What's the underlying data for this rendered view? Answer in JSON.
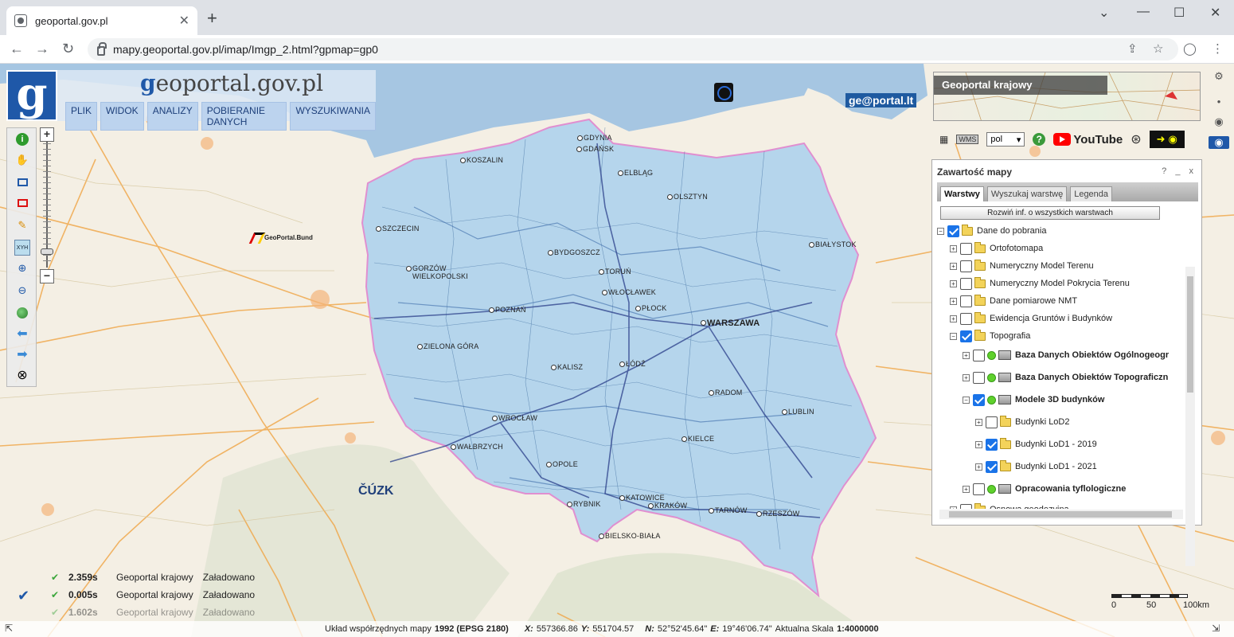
{
  "browser": {
    "tab_title": "geoportal.gov.pl",
    "url": "mapy.geoportal.gov.pl/imap/Imgp_2.html?gpmap=gp0"
  },
  "header": {
    "site_prefix": "g",
    "site_rest": "eoportal.gov.pl",
    "menu": [
      "PLIK",
      "WIDOK",
      "ANALIZY",
      "POBIERANIE DANYCH",
      "WYSZUKIWANIA"
    ]
  },
  "map": {
    "cities": [
      {
        "name": "GDYNIA",
        "big": false
      },
      {
        "name": "GDAŃSK",
        "big": false
      },
      {
        "name": "KOSZALIN",
        "big": false
      },
      {
        "name": "ELBLĄG",
        "big": false
      },
      {
        "name": "OLSZTYN",
        "big": false
      },
      {
        "name": "SZCZECIN",
        "big": false
      },
      {
        "name": "BYDGOSZCZ",
        "big": false
      },
      {
        "name": "TORUŃ",
        "big": false
      },
      {
        "name": "BIAŁYSTOK",
        "big": false
      },
      {
        "name": "GORZÓW WIELKOPOLSKI",
        "big": false
      },
      {
        "name": "WŁOCŁAWEK",
        "big": false
      },
      {
        "name": "PŁOCK",
        "big": false
      },
      {
        "name": "POZNAŃ",
        "big": false
      },
      {
        "name": "WARSZAWA",
        "big": true
      },
      {
        "name": "ZIELONA GÓRA",
        "big": false
      },
      {
        "name": "KALISZ",
        "big": false
      },
      {
        "name": "ŁÓDŹ",
        "big": false
      },
      {
        "name": "RADOM",
        "big": false
      },
      {
        "name": "LUBLIN",
        "big": false
      },
      {
        "name": "WROCŁAW",
        "big": false
      },
      {
        "name": "WAŁBRZYCH",
        "big": false
      },
      {
        "name": "KIELCE",
        "big": false
      },
      {
        "name": "OPOLE",
        "big": false
      },
      {
        "name": "KATOWICE",
        "big": false
      },
      {
        "name": "RYBNIK",
        "big": false
      },
      {
        "name": "KRAKÓW",
        "big": false
      },
      {
        "name": "TARNÓW",
        "big": false
      },
      {
        "name": "RZESZÓW",
        "big": false
      },
      {
        "name": "BIELSKO-BIAŁA",
        "big": false
      }
    ],
    "logos": {
      "lt": "ge@portal.lt",
      "bund": "GeoPortal.Bund",
      "cuzk": "ČÚZK"
    }
  },
  "right_panel": {
    "preview_title": "Geoportal krajowy",
    "language": "pol",
    "youtube": "YouTube"
  },
  "layers_panel": {
    "title": "Zawartość mapy",
    "controls": "? _ x",
    "tabs": [
      "Warstwy",
      "Wyszukaj warstwę",
      "Legenda"
    ],
    "expand_all": "Rozwiń inf. o wszystkich warstwach",
    "tree": [
      {
        "label": "Dane do pobrania",
        "level": 0,
        "expander": "−",
        "checked": true,
        "icon": "folder",
        "bold": false
      },
      {
        "label": "Ortofotomapa",
        "level": 1,
        "expander": "+",
        "checked": false,
        "icon": "folder",
        "bold": false
      },
      {
        "label": "Numeryczny Model Terenu",
        "level": 1,
        "expander": "+",
        "checked": false,
        "icon": "folder",
        "bold": false
      },
      {
        "label": "Numeryczny Model Pokrycia Terenu",
        "level": 1,
        "expander": "+",
        "checked": false,
        "icon": "folder",
        "bold": false
      },
      {
        "label": "Dane pomiarowe NMT",
        "level": 1,
        "expander": "+",
        "checked": false,
        "icon": "folder",
        "bold": false
      },
      {
        "label": "Ewidencja Gruntów i Budynków",
        "level": 1,
        "expander": "+",
        "checked": false,
        "icon": "folder",
        "bold": false
      },
      {
        "label": "Topografia",
        "level": 1,
        "expander": "−",
        "checked": true,
        "icon": "folder",
        "bold": false
      },
      {
        "label": "Baza Danych Obiektów Ogólnogeogr",
        "level": 2,
        "expander": "+",
        "checked": false,
        "icon": "wms",
        "bold": true
      },
      {
        "label": "Baza Danych Obiektów Topograficzn",
        "level": 2,
        "expander": "+",
        "checked": false,
        "icon": "wms",
        "bold": true
      },
      {
        "label": "Modele 3D budynków",
        "level": 2,
        "expander": "−",
        "checked": true,
        "icon": "wms",
        "bold": true
      },
      {
        "label": "Budynki LoD2",
        "level": 3,
        "expander": "+",
        "checked": false,
        "icon": "folder",
        "bold": false
      },
      {
        "label": "Budynki LoD1 - 2019",
        "level": 3,
        "expander": "+",
        "checked": true,
        "icon": "folder",
        "bold": false
      },
      {
        "label": "Budynki LoD1 - 2021",
        "level": 3,
        "expander": "+",
        "checked": true,
        "icon": "folder",
        "bold": false
      },
      {
        "label": "Opracowania tyflologiczne",
        "level": 2,
        "expander": "+",
        "checked": false,
        "icon": "wms",
        "bold": true
      },
      {
        "label": "Osnowa geodezyjna",
        "level": 1,
        "expander": "+",
        "checked": false,
        "icon": "folder",
        "bold": false
      }
    ]
  },
  "loader": [
    {
      "time": "2.359s",
      "source": "Geoportal krajowy",
      "status": "Załadowano"
    },
    {
      "time": "0.005s",
      "source": "Geoportal krajowy",
      "status": "Załadowano"
    },
    {
      "time": "1.602s",
      "source": "Geoportal krajowy",
      "status": "Załadowano"
    }
  ],
  "status": {
    "crs_label": "Układ współrzędnych mapy",
    "crs_value": "1992 (EPSG 2180)",
    "x_label": "X:",
    "x_value": "557366.86",
    "y_label": "Y:",
    "y_value": "551704.57",
    "n_label": "N:",
    "n_value": "52°52'45.64\"",
    "e_label": "E:",
    "e_value": "19°46'06.74\"",
    "scale_label": "Aktualna Skala",
    "scale_value": "1:4000000"
  },
  "scalebar": {
    "labels": [
      "0",
      "50",
      "100km"
    ]
  },
  "colors": {
    "accent": "#1f58a8",
    "poland_fill": "#8ec5f0",
    "loaded_ok": "#3aa63a"
  }
}
